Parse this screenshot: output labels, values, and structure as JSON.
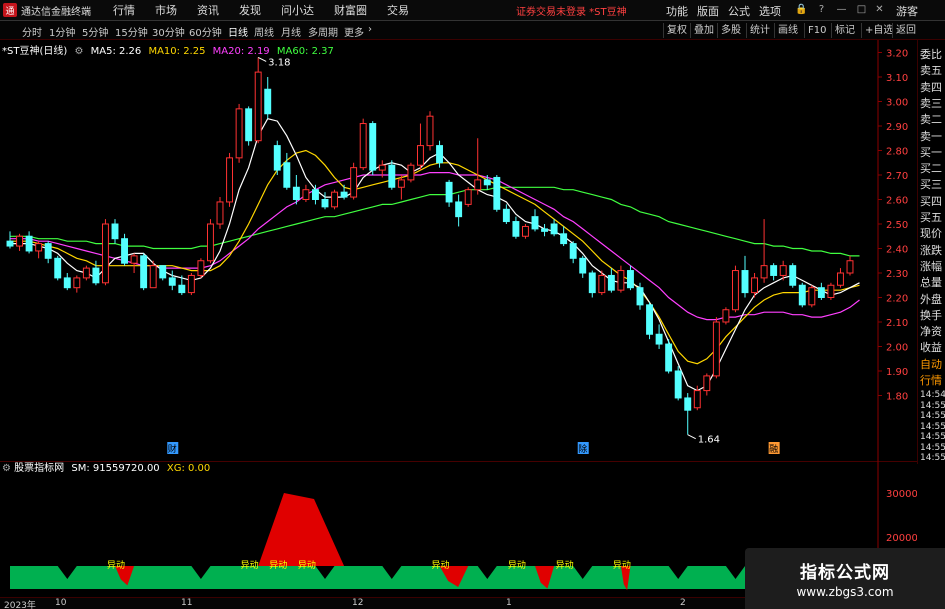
{
  "titlebar": {
    "app_title": "通达信金融终端",
    "menus": [
      "行情",
      "市场",
      "资讯",
      "发现",
      "问小达",
      "财富圈",
      "交易"
    ],
    "notice": "证券交易未登录 *ST豆神",
    "right_menus": [
      "功能",
      "版面",
      "公式",
      "选项"
    ],
    "guest": "游客"
  },
  "toolbar": {
    "periods": [
      "分时",
      "1分钟",
      "5分钟",
      "15分钟",
      "30分钟",
      "60分钟",
      "日线",
      "周线",
      "月线",
      "多周期",
      "更多"
    ],
    "active_period": "日线",
    "right_buttons": [
      "复权",
      "叠加",
      "多股",
      "统计",
      "画线",
      "F10",
      "标记",
      "+自选",
      "返回"
    ]
  },
  "main_legend": {
    "symbol": "*ST豆神(日线)",
    "ma5": "MA5: 2.26",
    "ma10": "MA10: 2.25",
    "ma20": "MA20: 2.19",
    "ma60": "MA60: 2.37"
  },
  "indicator_legend": {
    "name": "股票指标网",
    "sm": "SM: 91559720.00",
    "xg": "XG: 0.00"
  },
  "side_panel": [
    "委比",
    "卖五",
    "卖四",
    "卖三",
    "卖二",
    "卖一",
    "买一",
    "买二",
    "买三",
    "买四",
    "买五",
    "现价",
    "涨跌",
    "涨幅",
    "总量",
    "外盘",
    "换手",
    "净资",
    "收益",
    "自动",
    "行情"
  ],
  "side_panel_times": [
    "14:54",
    "14:55",
    "14:55",
    "14:55",
    "14:55",
    "14:55",
    "14:55"
  ],
  "price_axis": [
    "3.20",
    "3.10",
    "3.00",
    "2.90",
    "2.80",
    "2.70",
    "2.60",
    "2.50",
    "2.40",
    "2.30",
    "2.20",
    "2.10",
    "2.00",
    "1.90",
    "1.80"
  ],
  "indicator_axis": [
    "30000",
    "20000"
  ],
  "annotations": {
    "high": "3.18",
    "low": "1.64",
    "markers": [
      "财",
      "除",
      "融"
    ],
    "yidong": "异动"
  },
  "date_axis": [
    "2023年",
    "10",
    "11",
    "12",
    "1",
    "2"
  ],
  "watermark": {
    "line1": "指标公式网",
    "line2": "www.zbgs3.com"
  },
  "colors": {
    "up": "#ff3232",
    "down": "#54ffff",
    "ma5": "#ffffff",
    "ma10": "#ffd700",
    "ma20": "#ff40ff",
    "ma60": "#40ff40",
    "green_area": "#00b050",
    "red_area": "#e00000",
    "yidong_text": "#ffff00"
  },
  "chart_data": {
    "type": "candlestick",
    "price_range": [
      1.6,
      3.25
    ],
    "candles": [
      {
        "o": 2.43,
        "h": 2.47,
        "l": 2.4,
        "c": 2.41
      },
      {
        "o": 2.41,
        "h": 2.46,
        "l": 2.39,
        "c": 2.45
      },
      {
        "o": 2.45,
        "h": 2.47,
        "l": 2.38,
        "c": 2.39
      },
      {
        "o": 2.39,
        "h": 2.43,
        "l": 2.36,
        "c": 2.42
      },
      {
        "o": 2.42,
        "h": 2.43,
        "l": 2.34,
        "c": 2.36
      },
      {
        "o": 2.36,
        "h": 2.37,
        "l": 2.27,
        "c": 2.28
      },
      {
        "o": 2.28,
        "h": 2.3,
        "l": 2.23,
        "c": 2.24
      },
      {
        "o": 2.24,
        "h": 2.29,
        "l": 2.22,
        "c": 2.28
      },
      {
        "o": 2.28,
        "h": 2.33,
        "l": 2.27,
        "c": 2.32
      },
      {
        "o": 2.32,
        "h": 2.35,
        "l": 2.25,
        "c": 2.26
      },
      {
        "o": 2.26,
        "h": 2.52,
        "l": 2.25,
        "c": 2.5
      },
      {
        "o": 2.5,
        "h": 2.52,
        "l": 2.42,
        "c": 2.44
      },
      {
        "o": 2.44,
        "h": 2.46,
        "l": 2.33,
        "c": 2.34
      },
      {
        "o": 2.34,
        "h": 2.38,
        "l": 2.3,
        "c": 2.37
      },
      {
        "o": 2.37,
        "h": 2.38,
        "l": 2.23,
        "c": 2.24
      },
      {
        "o": 2.24,
        "h": 2.35,
        "l": 2.24,
        "c": 2.33
      },
      {
        "o": 2.33,
        "h": 2.33,
        "l": 2.27,
        "c": 2.28
      },
      {
        "o": 2.28,
        "h": 2.31,
        "l": 2.23,
        "c": 2.25
      },
      {
        "o": 2.25,
        "h": 2.29,
        "l": 2.21,
        "c": 2.22
      },
      {
        "o": 2.22,
        "h": 2.3,
        "l": 2.21,
        "c": 2.29
      },
      {
        "o": 2.29,
        "h": 2.36,
        "l": 2.28,
        "c": 2.35
      },
      {
        "o": 2.35,
        "h": 2.52,
        "l": 2.34,
        "c": 2.5
      },
      {
        "o": 2.5,
        "h": 2.61,
        "l": 2.48,
        "c": 2.59
      },
      {
        "o": 2.59,
        "h": 2.79,
        "l": 2.57,
        "c": 2.77
      },
      {
        "o": 2.77,
        "h": 2.99,
        "l": 2.75,
        "c": 2.97
      },
      {
        "o": 2.97,
        "h": 2.98,
        "l": 2.82,
        "c": 2.84
      },
      {
        "o": 2.84,
        "h": 3.18,
        "l": 2.83,
        "c": 3.12
      },
      {
        "o": 3.05,
        "h": 3.1,
        "l": 2.93,
        "c": 2.95
      },
      {
        "o": 2.82,
        "h": 2.84,
        "l": 2.7,
        "c": 2.72
      },
      {
        "o": 2.75,
        "h": 2.79,
        "l": 2.64,
        "c": 2.65
      },
      {
        "o": 2.65,
        "h": 2.7,
        "l": 2.58,
        "c": 2.6
      },
      {
        "o": 2.6,
        "h": 2.66,
        "l": 2.59,
        "c": 2.64
      },
      {
        "o": 2.64,
        "h": 2.66,
        "l": 2.58,
        "c": 2.6
      },
      {
        "o": 2.6,
        "h": 2.63,
        "l": 2.56,
        "c": 2.57
      },
      {
        "o": 2.57,
        "h": 2.64,
        "l": 2.56,
        "c": 2.63
      },
      {
        "o": 2.63,
        "h": 2.66,
        "l": 2.6,
        "c": 2.61
      },
      {
        "o": 2.61,
        "h": 2.75,
        "l": 2.6,
        "c": 2.73
      },
      {
        "o": 2.73,
        "h": 2.93,
        "l": 2.72,
        "c": 2.91
      },
      {
        "o": 2.91,
        "h": 2.92,
        "l": 2.7,
        "c": 2.72
      },
      {
        "o": 2.72,
        "h": 2.76,
        "l": 2.69,
        "c": 2.74
      },
      {
        "o": 2.74,
        "h": 2.76,
        "l": 2.64,
        "c": 2.65
      },
      {
        "o": 2.65,
        "h": 2.7,
        "l": 2.6,
        "c": 2.68
      },
      {
        "o": 2.68,
        "h": 2.75,
        "l": 2.67,
        "c": 2.74
      },
      {
        "o": 2.74,
        "h": 2.91,
        "l": 2.72,
        "c": 2.82
      },
      {
        "o": 2.82,
        "h": 2.96,
        "l": 2.8,
        "c": 2.94
      },
      {
        "o": 2.82,
        "h": 2.84,
        "l": 2.73,
        "c": 2.75
      },
      {
        "o": 2.67,
        "h": 2.68,
        "l": 2.57,
        "c": 2.59
      },
      {
        "o": 2.59,
        "h": 2.62,
        "l": 2.49,
        "c": 2.53
      },
      {
        "o": 2.58,
        "h": 2.65,
        "l": 2.57,
        "c": 2.64
      },
      {
        "o": 2.64,
        "h": 2.85,
        "l": 2.62,
        "c": 2.68
      },
      {
        "o": 2.68,
        "h": 2.7,
        "l": 2.64,
        "c": 2.66
      },
      {
        "o": 2.69,
        "h": 2.7,
        "l": 2.55,
        "c": 2.56
      },
      {
        "o": 2.56,
        "h": 2.58,
        "l": 2.5,
        "c": 2.51
      },
      {
        "o": 2.51,
        "h": 2.53,
        "l": 2.44,
        "c": 2.45
      },
      {
        "o": 2.45,
        "h": 2.5,
        "l": 2.44,
        "c": 2.49
      },
      {
        "o": 2.53,
        "h": 2.56,
        "l": 2.47,
        "c": 2.48
      },
      {
        "o": 2.48,
        "h": 2.5,
        "l": 2.45,
        "c": 2.47
      },
      {
        "o": 2.5,
        "h": 2.52,
        "l": 2.45,
        "c": 2.46
      },
      {
        "o": 2.46,
        "h": 2.49,
        "l": 2.41,
        "c": 2.42
      },
      {
        "o": 2.42,
        "h": 2.43,
        "l": 2.34,
        "c": 2.36
      },
      {
        "o": 2.36,
        "h": 2.37,
        "l": 2.28,
        "c": 2.3
      },
      {
        "o": 2.3,
        "h": 2.31,
        "l": 2.2,
        "c": 2.22
      },
      {
        "o": 2.22,
        "h": 2.31,
        "l": 2.21,
        "c": 2.29
      },
      {
        "o": 2.29,
        "h": 2.32,
        "l": 2.22,
        "c": 2.23
      },
      {
        "o": 2.23,
        "h": 2.33,
        "l": 2.22,
        "c": 2.31
      },
      {
        "o": 2.31,
        "h": 2.33,
        "l": 2.23,
        "c": 2.24
      },
      {
        "o": 2.24,
        "h": 2.26,
        "l": 2.15,
        "c": 2.17
      },
      {
        "o": 2.17,
        "h": 2.18,
        "l": 2.03,
        "c": 2.05
      },
      {
        "o": 2.05,
        "h": 2.09,
        "l": 1.99,
        "c": 2.01
      },
      {
        "o": 2.01,
        "h": 2.03,
        "l": 1.89,
        "c": 1.9
      },
      {
        "o": 1.9,
        "h": 1.92,
        "l": 1.78,
        "c": 1.79
      },
      {
        "o": 1.79,
        "h": 1.81,
        "l": 1.64,
        "c": 1.74
      },
      {
        "o": 1.75,
        "h": 1.84,
        "l": 1.74,
        "c": 1.82
      },
      {
        "o": 1.82,
        "h": 1.89,
        "l": 1.8,
        "c": 1.88
      },
      {
        "o": 1.88,
        "h": 2.12,
        "l": 1.87,
        "c": 2.1
      },
      {
        "o": 2.1,
        "h": 2.16,
        "l": 2.09,
        "c": 2.15
      },
      {
        "o": 2.15,
        "h": 2.33,
        "l": 2.14,
        "c": 2.31
      },
      {
        "o": 2.31,
        "h": 2.37,
        "l": 2.2,
        "c": 2.22
      },
      {
        "o": 2.22,
        "h": 2.3,
        "l": 2.2,
        "c": 2.28
      },
      {
        "o": 2.28,
        "h": 2.52,
        "l": 2.26,
        "c": 2.33
      },
      {
        "o": 2.33,
        "h": 2.34,
        "l": 2.27,
        "c": 2.29
      },
      {
        "o": 2.29,
        "h": 2.35,
        "l": 2.27,
        "c": 2.33
      },
      {
        "o": 2.33,
        "h": 2.34,
        "l": 2.24,
        "c": 2.25
      },
      {
        "o": 2.25,
        "h": 2.26,
        "l": 2.16,
        "c": 2.17
      },
      {
        "o": 2.17,
        "h": 2.25,
        "l": 2.16,
        "c": 2.24
      },
      {
        "o": 2.24,
        "h": 2.26,
        "l": 2.19,
        "c": 2.2
      },
      {
        "o": 2.2,
        "h": 2.26,
        "l": 2.19,
        "c": 2.25
      },
      {
        "o": 2.25,
        "h": 2.32,
        "l": 2.24,
        "c": 2.3
      },
      {
        "o": 2.3,
        "h": 2.37,
        "l": 2.29,
        "c": 2.35
      }
    ],
    "ma5": [
      2.42,
      2.42,
      2.42,
      2.41,
      2.4,
      2.38,
      2.34,
      2.31,
      2.3,
      2.28,
      2.32,
      2.36,
      2.37,
      2.38,
      2.38,
      2.34,
      2.31,
      2.29,
      2.28,
      2.27,
      2.28,
      2.32,
      2.39,
      2.5,
      2.64,
      2.73,
      2.86,
      2.93,
      2.92,
      2.86,
      2.78,
      2.69,
      2.64,
      2.61,
      2.61,
      2.61,
      2.63,
      2.69,
      2.72,
      2.74,
      2.75,
      2.74,
      2.71,
      2.73,
      2.77,
      2.79,
      2.75,
      2.7,
      2.67,
      2.64,
      2.62,
      2.61,
      2.59,
      2.54,
      2.51,
      2.5,
      2.48,
      2.47,
      2.45,
      2.42,
      2.38,
      2.33,
      2.3,
      2.27,
      2.26,
      2.26,
      2.24,
      2.18,
      2.11,
      2.02,
      1.93,
      1.84,
      1.82,
      1.84,
      1.91,
      1.99,
      2.07,
      2.15,
      2.21,
      2.24,
      2.26,
      2.28,
      2.29,
      2.27,
      2.25,
      2.23,
      2.21,
      2.22,
      2.24,
      2.26
    ],
    "ma10": [
      2.43,
      2.43,
      2.43,
      2.42,
      2.41,
      2.4,
      2.38,
      2.36,
      2.35,
      2.33,
      2.33,
      2.33,
      2.33,
      2.33,
      2.33,
      2.33,
      2.33,
      2.33,
      2.32,
      2.31,
      2.31,
      2.31,
      2.33,
      2.37,
      2.43,
      2.5,
      2.58,
      2.66,
      2.72,
      2.76,
      2.79,
      2.8,
      2.78,
      2.74,
      2.69,
      2.65,
      2.64,
      2.65,
      2.66,
      2.67,
      2.68,
      2.69,
      2.7,
      2.72,
      2.74,
      2.75,
      2.75,
      2.74,
      2.72,
      2.7,
      2.68,
      2.66,
      2.64,
      2.62,
      2.6,
      2.58,
      2.55,
      2.52,
      2.49,
      2.46,
      2.43,
      2.39,
      2.35,
      2.32,
      2.29,
      2.27,
      2.23,
      2.18,
      2.12,
      2.05,
      1.98,
      1.94,
      1.93,
      1.95,
      1.99,
      2.04,
      2.08,
      2.12,
      2.16,
      2.19,
      2.21,
      2.22,
      2.22,
      2.22,
      2.23,
      2.23,
      2.23,
      2.23,
      2.24,
      2.25
    ],
    "ma20": [
      2.44,
      2.44,
      2.44,
      2.43,
      2.43,
      2.42,
      2.41,
      2.4,
      2.39,
      2.38,
      2.37,
      2.36,
      2.35,
      2.34,
      2.33,
      2.33,
      2.32,
      2.32,
      2.32,
      2.32,
      2.32,
      2.33,
      2.35,
      2.38,
      2.41,
      2.44,
      2.48,
      2.51,
      2.54,
      2.57,
      2.59,
      2.62,
      2.64,
      2.66,
      2.67,
      2.68,
      2.69,
      2.7,
      2.7,
      2.7,
      2.7,
      2.7,
      2.7,
      2.7,
      2.71,
      2.71,
      2.71,
      2.7,
      2.7,
      2.7,
      2.69,
      2.68,
      2.66,
      2.64,
      2.62,
      2.6,
      2.58,
      2.56,
      2.53,
      2.51,
      2.48,
      2.45,
      2.42,
      2.39,
      2.36,
      2.33,
      2.3,
      2.27,
      2.24,
      2.2,
      2.17,
      2.14,
      2.12,
      2.11,
      2.11,
      2.12,
      2.12,
      2.13,
      2.13,
      2.14,
      2.14,
      2.14,
      2.13,
      2.13,
      2.12,
      2.12,
      2.13,
      2.14,
      2.16,
      2.19
    ],
    "ma60": [
      2.45,
      2.45,
      2.45,
      2.44,
      2.44,
      2.44,
      2.43,
      2.43,
      2.43,
      2.42,
      2.42,
      2.42,
      2.41,
      2.41,
      2.41,
      2.4,
      2.4,
      2.4,
      2.4,
      2.4,
      2.41,
      2.41,
      2.42,
      2.43,
      2.44,
      2.45,
      2.46,
      2.47,
      2.48,
      2.49,
      2.5,
      2.51,
      2.52,
      2.53,
      2.53,
      2.54,
      2.55,
      2.56,
      2.57,
      2.58,
      2.58,
      2.59,
      2.6,
      2.61,
      2.62,
      2.62,
      2.62,
      2.63,
      2.64,
      2.64,
      2.64,
      2.65,
      2.65,
      2.65,
      2.65,
      2.65,
      2.65,
      2.65,
      2.64,
      2.64,
      2.63,
      2.62,
      2.61,
      2.6,
      2.58,
      2.57,
      2.55,
      2.54,
      2.53,
      2.51,
      2.5,
      2.49,
      2.48,
      2.47,
      2.46,
      2.45,
      2.44,
      2.43,
      2.42,
      2.42,
      2.41,
      2.41,
      2.4,
      2.4,
      2.39,
      2.39,
      2.38,
      2.38,
      2.37,
      2.37
    ],
    "markers": [
      {
        "text": "财",
        "index": 17
      },
      {
        "text": "除",
        "index": 60
      },
      {
        "text": "融",
        "index": 80
      }
    ],
    "indicator": {
      "green_bands": [
        [
          0,
          89
        ]
      ],
      "red_peaks": [
        {
          "from": 11,
          "to": 13,
          "value": 3000
        },
        {
          "from": 26,
          "to": 35,
          "value": 30000
        },
        {
          "from": 45,
          "to": 48,
          "value": 2500
        },
        {
          "from": 55,
          "to": 57,
          "value": 2000
        },
        {
          "from": 64,
          "to": 65,
          "value": 1500
        },
        {
          "from": 92,
          "to": 98,
          "value": 4000
        }
      ],
      "yidong_at": [
        11,
        25,
        28,
        31,
        45,
        53,
        58,
        64,
        93
      ]
    }
  }
}
